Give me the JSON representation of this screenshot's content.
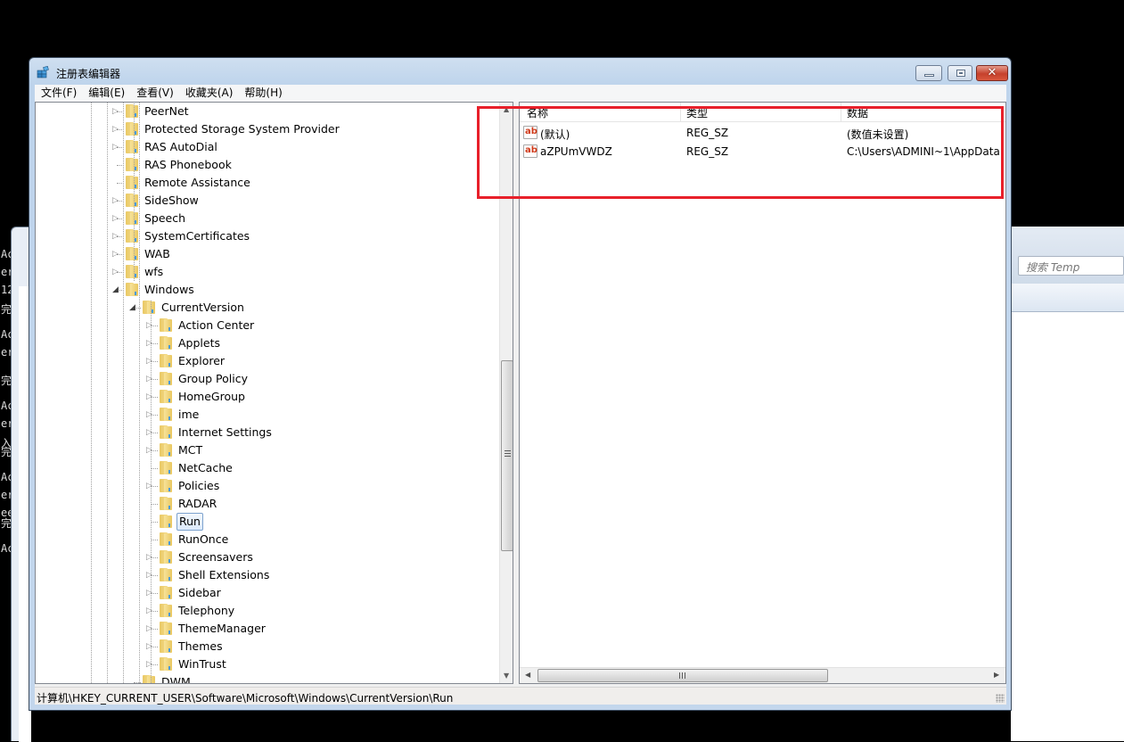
{
  "window": {
    "title": "注册表编辑器",
    "controls": {
      "minimize": "minimize",
      "maximize": "maximize",
      "close": "✕"
    }
  },
  "menu": [
    "文件(F)",
    "编辑(E)",
    "查看(V)",
    "收藏夹(A)",
    "帮助(H)"
  ],
  "tree": {
    "items": [
      {
        "label": "PeerNet",
        "level": 0,
        "expander": "collapsed"
      },
      {
        "label": "Protected Storage System Provider",
        "level": 0,
        "expander": "collapsed"
      },
      {
        "label": "RAS AutoDial",
        "level": 0,
        "expander": "collapsed"
      },
      {
        "label": "RAS Phonebook",
        "level": 0,
        "expander": "none"
      },
      {
        "label": "Remote Assistance",
        "level": 0,
        "expander": "none"
      },
      {
        "label": "SideShow",
        "level": 0,
        "expander": "collapsed"
      },
      {
        "label": "Speech",
        "level": 0,
        "expander": "collapsed"
      },
      {
        "label": "SystemCertificates",
        "level": 0,
        "expander": "collapsed"
      },
      {
        "label": "WAB",
        "level": 0,
        "expander": "collapsed"
      },
      {
        "label": "wfs",
        "level": 0,
        "expander": "collapsed"
      },
      {
        "label": "Windows",
        "level": 0,
        "expander": "expanded"
      },
      {
        "label": "CurrentVersion",
        "level": 1,
        "expander": "expanded"
      },
      {
        "label": "Action Center",
        "level": 2,
        "expander": "collapsed"
      },
      {
        "label": "Applets",
        "level": 2,
        "expander": "collapsed"
      },
      {
        "label": "Explorer",
        "level": 2,
        "expander": "collapsed"
      },
      {
        "label": "Group Policy",
        "level": 2,
        "expander": "collapsed"
      },
      {
        "label": "HomeGroup",
        "level": 2,
        "expander": "collapsed"
      },
      {
        "label": "ime",
        "level": 2,
        "expander": "collapsed"
      },
      {
        "label": "Internet Settings",
        "level": 2,
        "expander": "collapsed"
      },
      {
        "label": "MCT",
        "level": 2,
        "expander": "collapsed"
      },
      {
        "label": "NetCache",
        "level": 2,
        "expander": "none"
      },
      {
        "label": "Policies",
        "level": 2,
        "expander": "collapsed"
      },
      {
        "label": "RADAR",
        "level": 2,
        "expander": "none"
      },
      {
        "label": "Run",
        "level": 2,
        "expander": "none",
        "selected": true
      },
      {
        "label": "RunOnce",
        "level": 2,
        "expander": "none"
      },
      {
        "label": "Screensavers",
        "level": 2,
        "expander": "collapsed"
      },
      {
        "label": "Shell Extensions",
        "level": 2,
        "expander": "collapsed"
      },
      {
        "label": "Sidebar",
        "level": 2,
        "expander": "collapsed"
      },
      {
        "label": "Telephony",
        "level": 2,
        "expander": "collapsed"
      },
      {
        "label": "ThemeManager",
        "level": 2,
        "expander": "collapsed"
      },
      {
        "label": "Themes",
        "level": 2,
        "expander": "collapsed"
      },
      {
        "label": "WinTrust",
        "level": 2,
        "expander": "collapsed"
      },
      {
        "label": "DWM",
        "level": 1,
        "expander": "none"
      }
    ]
  },
  "list": {
    "columns": [
      "名称",
      "类型",
      "数据"
    ],
    "rows": [
      {
        "icon": "ab",
        "name": "(默认)",
        "type": "REG_SZ",
        "data": "(数值未设置)"
      },
      {
        "icon": "ab",
        "name": "aZPUmVWDZ",
        "type": "REG_SZ",
        "data": "C:\\Users\\ADMINI~1\\AppData"
      }
    ]
  },
  "status": {
    "path": "计算机\\HKEY_CURRENT_USER\\Software\\Microsoft\\Windows\\CurrentVersion\\Run"
  },
  "background": {
    "explorer_search_placeholder": "搜索 Temp",
    "console_lines": [
      "Ac",
      "er",
      "12",
      "完",
      "Ac",
      "er",
      "完",
      "Ac",
      "er",
      "入",
      "完",
      "Ac",
      "er",
      "ee",
      "完",
      "Ac"
    ]
  },
  "colors": {
    "highlight_box": "#e8202a",
    "selection_border": "#7da2ce"
  }
}
